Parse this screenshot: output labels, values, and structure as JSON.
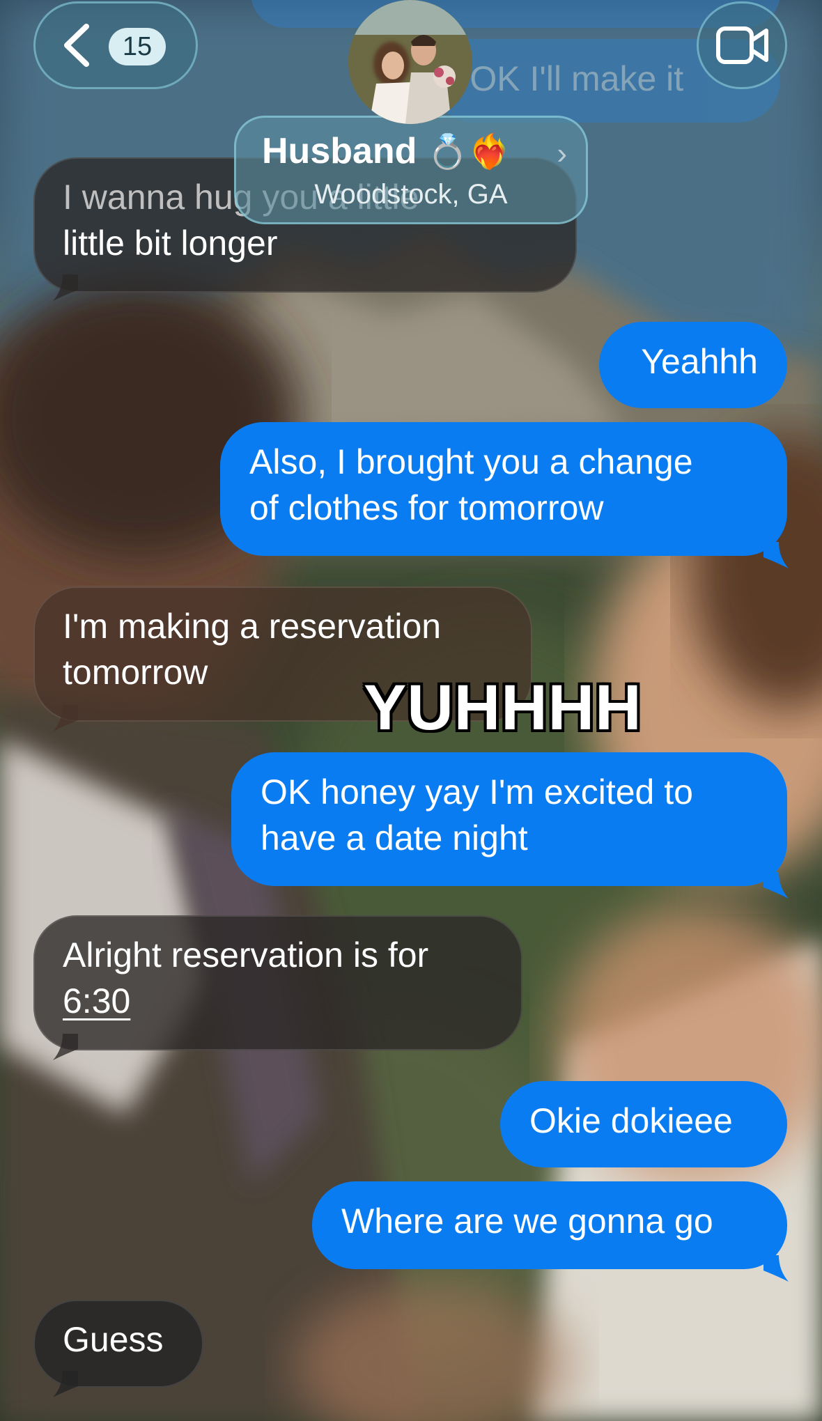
{
  "header": {
    "back_badge_count": "15",
    "contact_name": "Husband",
    "contact_emoji": "💍❤️‍🔥",
    "contact_location": "Woodstock, GA",
    "icons": {
      "back": "chevron-left-icon",
      "video": "video-camera-icon",
      "contact_chevron": "chevron-right-icon"
    }
  },
  "colors": {
    "sent_bubble": "#0a7cf2",
    "received_bubble": "#2c2826",
    "header_glass": "#3c6e82"
  },
  "messages": [
    {
      "direction": "sent",
      "lines": [
        "t's OK I'll make it"
      ]
    },
    {
      "direction": "received",
      "lines": [
        "I wanna hug you a little",
        "little bit longer"
      ]
    },
    {
      "direction": "sent",
      "lines": [
        "Yeahhh"
      ]
    },
    {
      "direction": "sent",
      "lines": [
        "Also, I brought you a change",
        "of clothes for tomorrow"
      ]
    },
    {
      "direction": "received",
      "lines": [
        "I'm making a reservation",
        "tomorrow"
      ]
    },
    {
      "direction": "sent",
      "lines": [
        "OK honey yay I'm excited to",
        "have a date night"
      ]
    },
    {
      "direction": "received",
      "lines": [
        "Alright reservation is for",
        "6:30"
      ]
    },
    {
      "direction": "sent",
      "lines": [
        "Okie dokieee"
      ]
    },
    {
      "direction": "sent",
      "lines": [
        "Where are we gonna go"
      ]
    },
    {
      "direction": "received",
      "lines": [
        "Guess"
      ]
    }
  ],
  "overlay_caption": "YUHHHH"
}
